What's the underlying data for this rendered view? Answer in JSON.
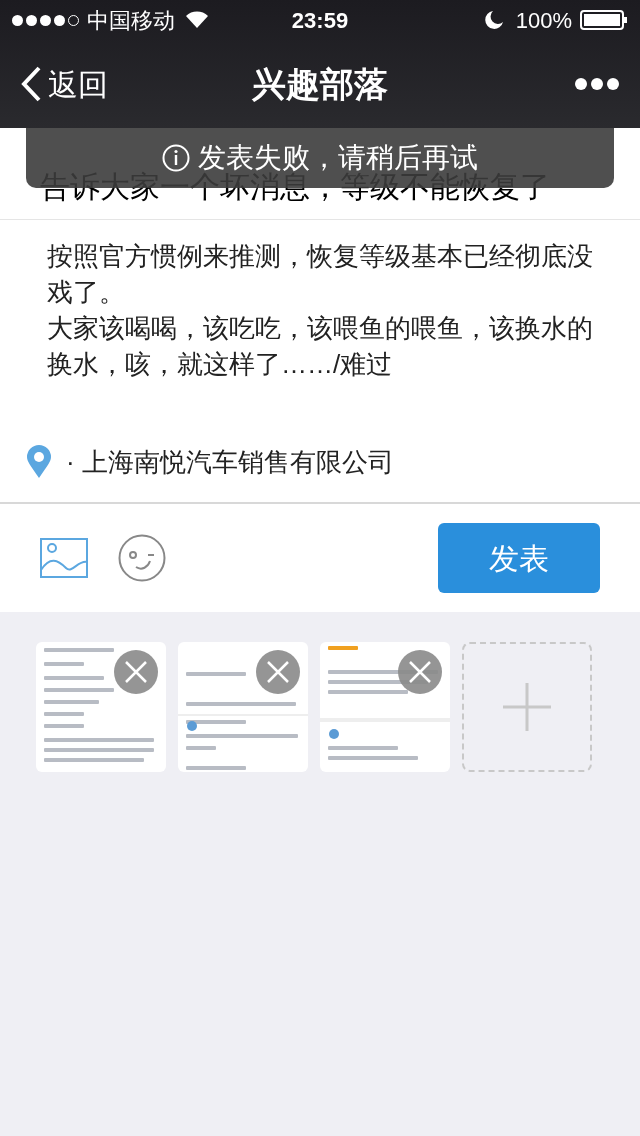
{
  "status_bar": {
    "signal_dots": [
      {
        "filled": true
      },
      {
        "filled": true
      },
      {
        "filled": true
      },
      {
        "filled": true
      },
      {
        "filled": false
      }
    ],
    "carrier": "中国移动",
    "time": "23:59",
    "battery": "100%"
  },
  "nav": {
    "back": "返回",
    "title": "兴趣部落"
  },
  "toast": {
    "text": "发表失败，请稍后再试"
  },
  "post": {
    "title": "告诉大家一个坏消息，等级不能恢复了",
    "body": [
      "按照官方惯例来推测，恢复等级基本已经彻底没戏了。",
      "大家该喝喝，该吃吃，该喂鱼的喂鱼，该换水的换水，咳，就这样了……/难过"
    ],
    "location": "· 上海南悦汽车销售有限公司"
  },
  "toolbar": {
    "submit": "发表"
  }
}
